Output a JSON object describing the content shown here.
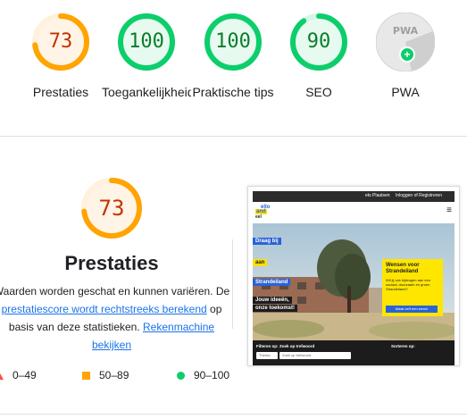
{
  "gauges": [
    {
      "label": "Prestaties",
      "score": "73",
      "value": 73,
      "color": "#ffa400"
    },
    {
      "label": "Toegankelijkheid",
      "score": "100",
      "value": 100,
      "color": "#0cce6b"
    },
    {
      "label": "Praktische tips",
      "score": "100",
      "value": 100,
      "color": "#0cce6b"
    },
    {
      "label": "SEO",
      "score": "90",
      "value": 90,
      "color": "#0cce6b"
    },
    {
      "label": "PWA",
      "score": "PWA",
      "value": null,
      "color": "#9e9e9e"
    }
  ],
  "performance": {
    "score": "73",
    "value": 73,
    "title": "Prestaties",
    "desc_before": "Waarden worden geschat en kunnen variëren. De ",
    "desc_link1": "prestatiescore wordt rechtstreeks berekend",
    "desc_middle": " op basis van deze statistieken. ",
    "desc_link2": "Rekenmachine bekijken",
    "legend": [
      {
        "range": "0–49"
      },
      {
        "range": "50–89"
      },
      {
        "range": "90–100"
      }
    ]
  },
  "screenshot": {
    "topbar_link1": "ets Plaatsen",
    "topbar_link2": "Inloggen of Registreren",
    "logo_line1": "ello",
    "logo_line2": "and",
    "logo_line3": "eel",
    "menu_icon": "hamburger-icon",
    "tag1": "Draag bij",
    "tag2": "aan",
    "tag3": "Strandeiland",
    "tag4": "Jouw ideeën,",
    "tag5": "onze toekomst!",
    "card_title": "Wensen voor Strandeiland",
    "card_body": "Wil jij ook bijdragen aan een sociaal, duurzaam en groen Strandeiland?",
    "card_button": "Maak zelf een wens!",
    "filter_label": "Filteren op:",
    "search_label": "Zoek op trefwoord",
    "sort_label": "Sorteren op:",
    "theme_value": "Thema",
    "search_placeholder": "Zoek op trefwoord"
  },
  "colors": {
    "orange": "#ffa400",
    "green": "#0cce6b",
    "red": "#ff4e42",
    "link": "#1a73e8"
  }
}
